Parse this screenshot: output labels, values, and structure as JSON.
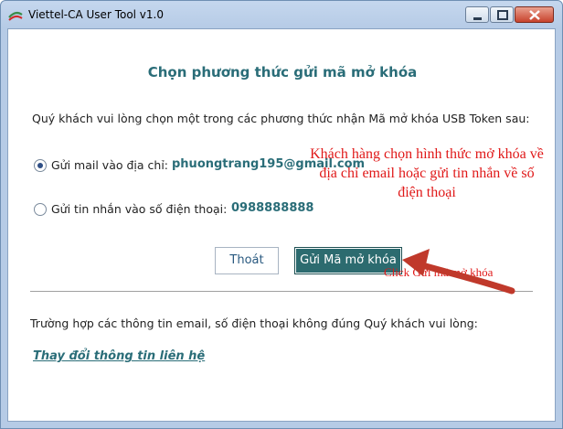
{
  "window": {
    "title": "Viettel-CA User Tool v1.0"
  },
  "dialog": {
    "heading": "Chọn phương thức gửi mã mở khóa",
    "instruction": "Quý khách vui lòng chọn một trong các phương thức nhận Mã mở khóa USB Token sau:",
    "options": [
      {
        "label": "Gửi mail vào địa chỉ:",
        "value": "phuongtrang195@gmail.com",
        "selected": true
      },
      {
        "label": "Gửi tin nhắn vào số điện thoại:",
        "value": "0988888888",
        "selected": false
      }
    ],
    "buttons": {
      "exit_label": "Thoát",
      "send_label": "Gửi Mã mở khóa"
    },
    "footer_text": "Trường hợp các thông tin email, số điện thoại không đúng Quý khách vui lòng:",
    "link_text": "Thay đổi thông tin liên hệ"
  },
  "annotations": {
    "main_note": "Khách hàng chọn hình thức mở khóa về địa chỉ email hoặc gửi tin nhắn về số điện thoại",
    "click_note": "Click Gửi mã mở khóa",
    "color": "#e01818"
  },
  "icons": {
    "app": "app-logo-icon",
    "minimize": "minimize-icon",
    "maximize": "maximize-icon",
    "close": "close-icon"
  },
  "colors": {
    "accent": "#2a6d78",
    "send_button": "#2c6b6f",
    "title_bar": "#c5d7ee"
  }
}
